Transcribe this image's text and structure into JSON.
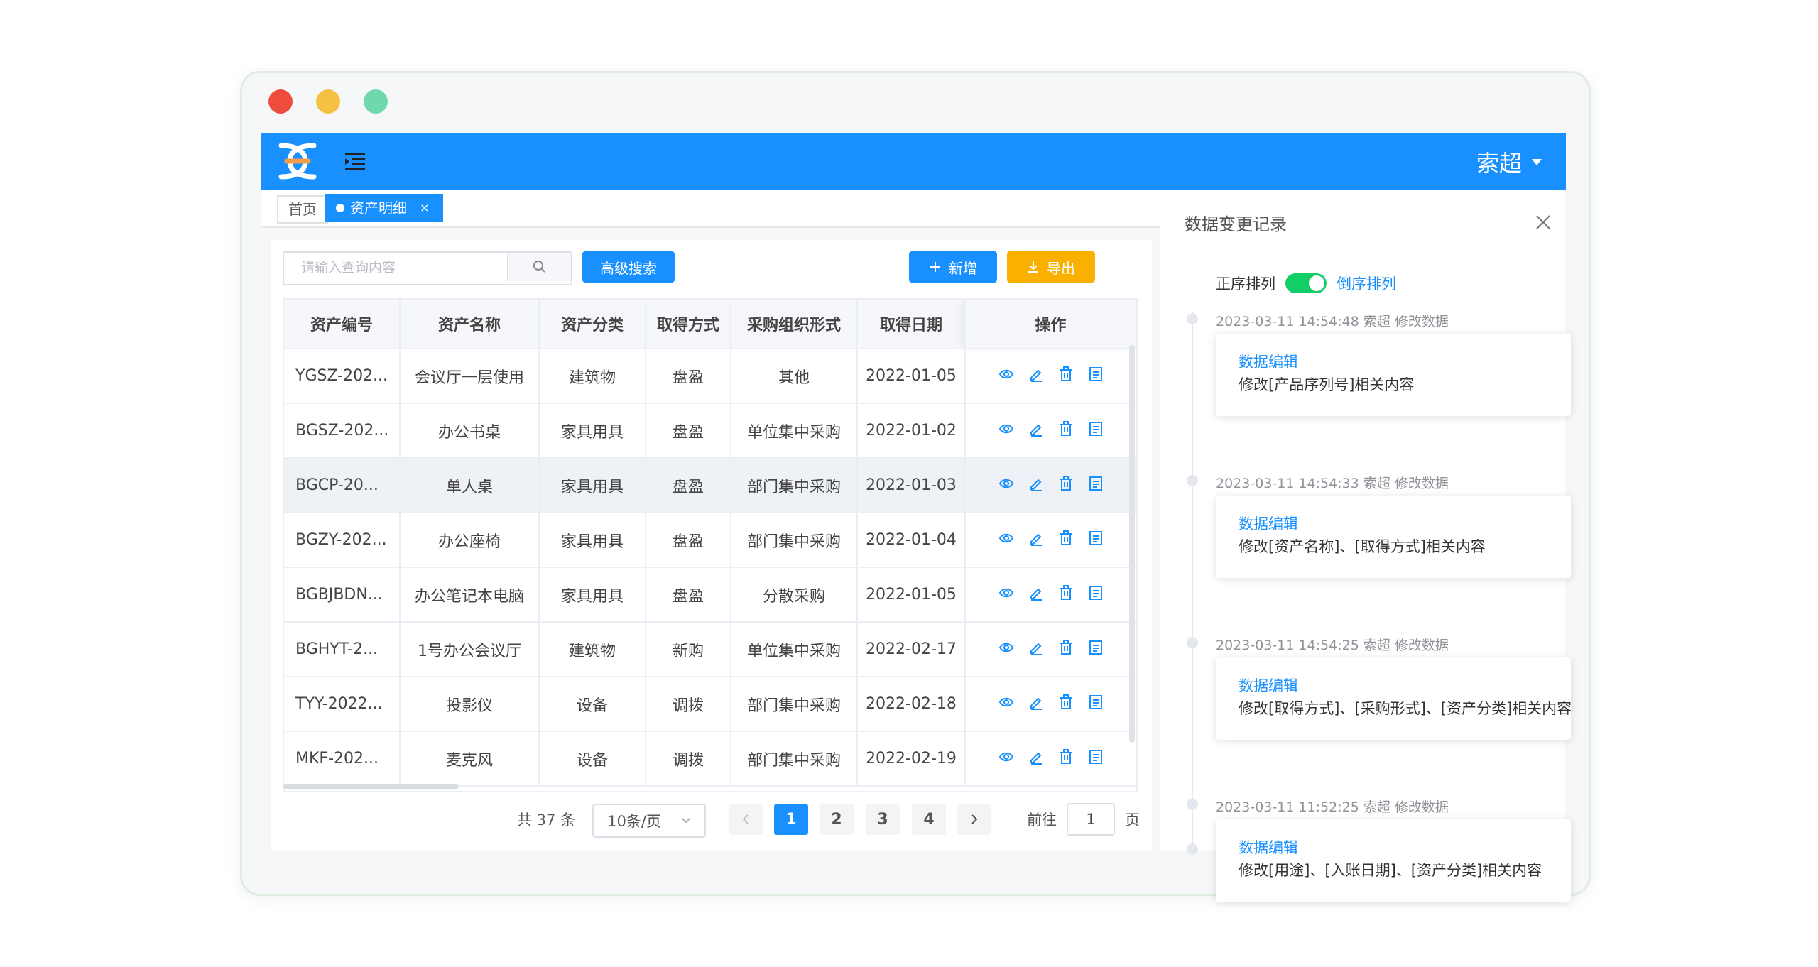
{
  "window": {
    "controls": [
      "close",
      "minimize",
      "maximize"
    ]
  },
  "header": {
    "user_name": "索超"
  },
  "tabs": {
    "home": "首页",
    "active": "资产明细",
    "close": "×"
  },
  "toolbar": {
    "search_placeholder": "请输入查询内容",
    "advanced_search": "高级搜索",
    "add": "新增",
    "export": "导出"
  },
  "table": {
    "columns": [
      "资产编号",
      "资产名称",
      "资产分类",
      "取得方式",
      "采购组织形式",
      "取得日期",
      "操作"
    ],
    "rows": [
      [
        "YGSZ-202...",
        "会议厅一层使用",
        "建筑物",
        "盘盈",
        "其他",
        "2022-01-05"
      ],
      [
        "BGSZ-202...",
        "办公书桌",
        "家具用具",
        "盘盈",
        "单位集中采购",
        "2022-01-02"
      ],
      [
        "BGCP-20...",
        "单人桌",
        "家具用具",
        "盘盈",
        "部门集中采购",
        "2022-01-03"
      ],
      [
        "BGZY-202...",
        "办公座椅",
        "家具用具",
        "盘盈",
        "部门集中采购",
        "2022-01-04"
      ],
      [
        "BGBJBDN...",
        "办公笔记本电脑",
        "家具用具",
        "盘盈",
        "分散采购",
        "2022-01-05"
      ],
      [
        "BGHYT-2...",
        "1号办公会议厅",
        "建筑物",
        "新购",
        "单位集中采购",
        "2022-02-17"
      ],
      [
        "TYY-2022...",
        "投影仪",
        "设备",
        "调拨",
        "部门集中采购",
        "2022-02-18"
      ],
      [
        "MKF-202...",
        "麦克风",
        "设备",
        "调拨",
        "部门集中采购",
        "2022-02-19"
      ]
    ],
    "row_actions": [
      "view-icon",
      "edit-icon",
      "delete-icon",
      "detail-icon"
    ]
  },
  "pagination": {
    "total": "共 37 条",
    "page_size": "10条/页",
    "pages": [
      "1",
      "2",
      "3",
      "4"
    ],
    "current": "1",
    "goto_label": "前往",
    "goto_value": "1",
    "goto_suffix": "页"
  },
  "panel": {
    "title": "数据变更记录",
    "sort_asc": "正序排列",
    "sort_desc": "倒序排列",
    "records": [
      {
        "time": "2023-03-11 14:54:48 索超 修改数据",
        "title": "数据编辑",
        "desc": "修改[产品序列号]相关内容"
      },
      {
        "time": "2023-03-11 14:54:33 索超 修改数据",
        "title": "数据编辑",
        "desc": "修改[资产名称]、[取得方式]相关内容"
      },
      {
        "time": "2023-03-11 14:54:25 索超 修改数据",
        "title": "数据编辑",
        "desc": "修改[取得方式]、[采购形式]、[资产分类]相关内容"
      },
      {
        "time": "2023-03-11 11:52:25 索超 修改数据",
        "title": "数据编辑",
        "desc": "修改[用途]、[入账日期]、[资产分类]相关内容"
      }
    ]
  },
  "colors": {
    "primary": "#1890ff",
    "warning": "#f9b000",
    "switch_on": "#13ce66"
  }
}
